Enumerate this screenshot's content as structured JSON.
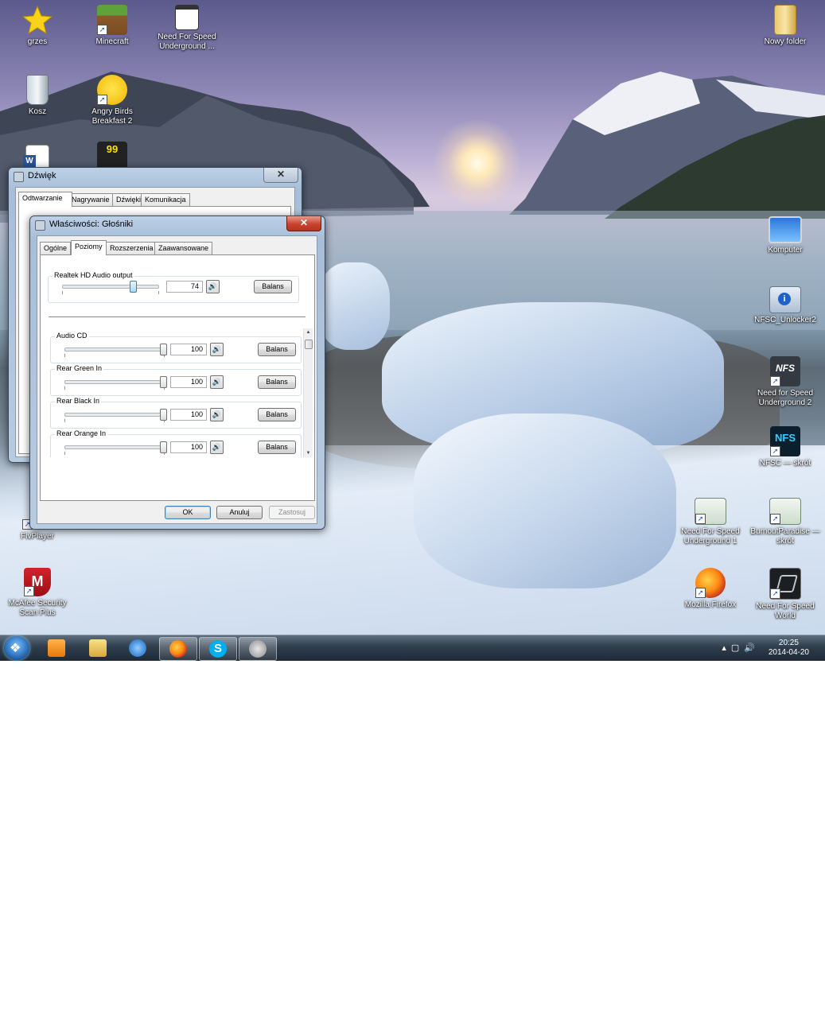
{
  "desktop": {
    "icons_left": [
      {
        "label": "grzes",
        "icon": "star-icon"
      },
      {
        "label": "Minecraft",
        "icon": "minecraft-icon"
      },
      {
        "label": "Need For Speed Underground ...",
        "icon": "window-shortcut-icon"
      },
      {
        "label": "Kosz",
        "icon": "recycle-bin-icon"
      },
      {
        "label": "Angry Birds Breakfast 2",
        "icon": "angry-bird-icon"
      },
      {
        "label": "FlvPlayer",
        "icon": "flvplayer-icon"
      },
      {
        "label": "McAfee Security Scan Plus",
        "icon": "mcafee-icon"
      }
    ],
    "icons_right": [
      {
        "label": "Nowy folder",
        "icon": "folder-icon"
      },
      {
        "label": "Komputer",
        "icon": "computer-icon"
      },
      {
        "label": "NFSC_Unlocker2",
        "icon": "info-app-icon"
      },
      {
        "label": "Need for Speed Underground 2",
        "icon": "nfs-icon"
      },
      {
        "label": "NFSC — skrót",
        "icon": "nfs-icon"
      },
      {
        "label": "Need For Speed Underground 1",
        "icon": "window-app-icon"
      },
      {
        "label": "BurnoutParadise — skrót",
        "icon": "window-app-icon"
      },
      {
        "label": "Mozilla Firefox",
        "icon": "firefox-icon"
      },
      {
        "label": "Need For Speed World",
        "icon": "nfs-world-icon"
      }
    ]
  },
  "sound_dialog": {
    "title": "Dźwięk",
    "tabs": [
      "Odtwarzanie",
      "Nagrywanie",
      "Dźwięki",
      "Komunikacja"
    ],
    "selected_tab": "Odtwarzanie"
  },
  "props_dialog": {
    "title": "Właściwości: Głośniki",
    "tabs": [
      "Ogólne",
      "Poziomy",
      "Rozszerzenia",
      "Zaawansowane"
    ],
    "selected_tab": "Poziomy",
    "master": {
      "label": "Realtek HD Audio output",
      "value": "74",
      "level": 0.74,
      "balance_label": "Balans"
    },
    "channels": [
      {
        "label": "Audio CD",
        "value": "100",
        "level": 1.0,
        "balance_label": "Balans"
      },
      {
        "label": "Rear Green In",
        "value": "100",
        "level": 1.0,
        "balance_label": "Balans"
      },
      {
        "label": "Rear Black In",
        "value": "100",
        "level": 1.0,
        "balance_label": "Balans"
      },
      {
        "label": "Rear Orange In",
        "value": "100",
        "level": 1.0,
        "balance_label": "Balans"
      }
    ],
    "buttons": {
      "ok": "OK",
      "cancel": "Anuluj",
      "apply": "Zastosuj"
    }
  },
  "taskbar": {
    "items": [
      "start-orb",
      "media-player-icon",
      "explorer-icon",
      "thunder-app-icon",
      "firefox-icon",
      "skype-icon",
      "sound-app-icon"
    ],
    "time": "20:25",
    "date": "2014-04-20"
  }
}
